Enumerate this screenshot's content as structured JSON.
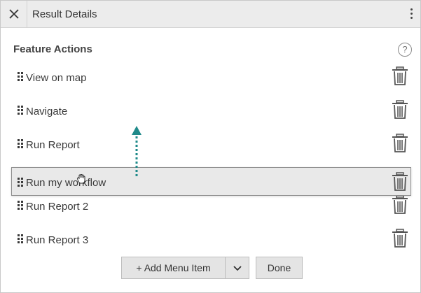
{
  "header": {
    "title": "Result Details",
    "close_icon": "close-icon",
    "menu_icon": "kebab-menu-icon"
  },
  "section": {
    "title": "Feature Actions",
    "help_glyph": "?"
  },
  "actions": [
    {
      "label": "View on map"
    },
    {
      "label": "Navigate"
    },
    {
      "label": "Run Report"
    },
    {
      "label": "Run my workflow",
      "state": "dragging"
    },
    {
      "label": "Run Report 2"
    },
    {
      "label": "Run Report 3"
    }
  ],
  "footer": {
    "add_plus": "+",
    "add_label": "Add Menu Item",
    "dropdown_icon": "chevron-down-icon",
    "done_label": "Done"
  },
  "colors": {
    "drag_arrow": "#1f8a8a",
    "header_bg": "#ececec",
    "button_bg": "#e4e4e4"
  }
}
